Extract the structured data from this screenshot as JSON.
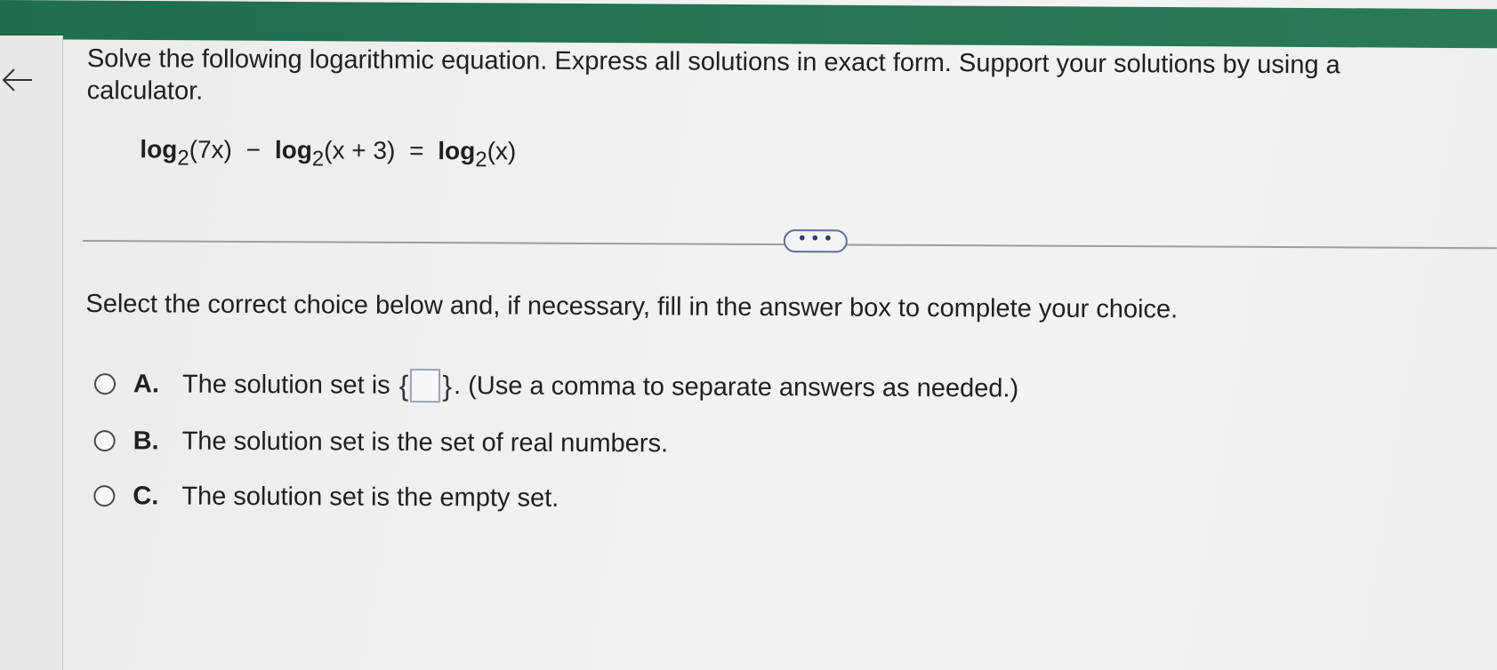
{
  "question": {
    "prompt": "Solve the following logarithmic equation. Express all solutions in exact form. Support your solutions by using a calculator.",
    "equation": {
      "term1_log": "log",
      "term1_base": "2",
      "term1_arg": "(7x)",
      "minus": "−",
      "term2_log": "log",
      "term2_base": "2",
      "term2_arg": "(x + 3)",
      "equals": "=",
      "term3_log": "log",
      "term3_base": "2",
      "term3_arg": "(x)"
    }
  },
  "more_button": {
    "label": "• • •"
  },
  "instruction": "Select the correct choice below and, if necessary, fill in the answer box to complete your choice.",
  "choices": [
    {
      "letter": "A.",
      "text_before": "The solution set is",
      "brace_open": "{",
      "brace_close": "}",
      "text_after": ". (Use a comma to separate answers as needed.)",
      "answer_value": ""
    },
    {
      "letter": "B.",
      "text": "The solution set is the set of real numbers."
    },
    {
      "letter": "C.",
      "text": "The solution set is the empty set."
    }
  ],
  "colors": {
    "header_bar": "#247553",
    "more_button_border": "#5b6fa0",
    "answer_box_border": "#9aa4b5"
  },
  "icons": {
    "back": "arrow-left-icon"
  }
}
